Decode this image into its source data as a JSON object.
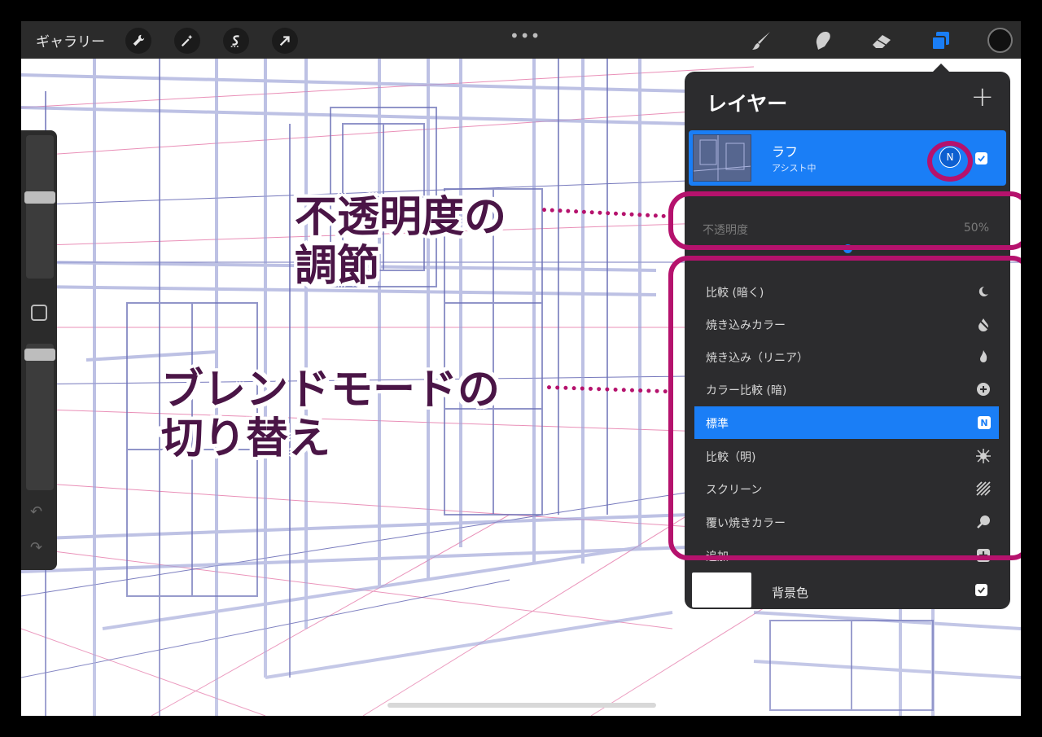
{
  "toolbar": {
    "gallery": "ギャラリー",
    "more": "•••",
    "tools_left": [
      "wrench-icon",
      "magic-wand-icon",
      "selection-s-icon",
      "transform-arrow-icon"
    ],
    "tools_right": [
      "brush-icon",
      "smudge-icon",
      "eraser-icon",
      "layers-icon"
    ]
  },
  "layers_panel": {
    "title": "レイヤー",
    "add": "+",
    "active_layer": {
      "name": "ラフ",
      "subtitle": "アシスト中",
      "blend_badge": "N"
    },
    "opacity": {
      "label": "不透明度",
      "value_text": "50%",
      "value": 0.5
    },
    "blend_modes": [
      {
        "label": "比較 (暗く)",
        "icon": "moon-icon",
        "active": false
      },
      {
        "label": "焼き込みカラー",
        "icon": "burn-drop-icon",
        "active": false
      },
      {
        "label": "焼き込み（リニア）",
        "icon": "flame-icon",
        "active": false
      },
      {
        "label": "カラー比較 (暗)",
        "icon": "plus-circle-icon",
        "active": false
      },
      {
        "label": "標準",
        "icon": "n-badge-icon",
        "active": true
      },
      {
        "label": "比較（明)",
        "icon": "sun-burst-icon",
        "active": false
      },
      {
        "label": "スクリーン",
        "icon": "hatch-square-icon",
        "active": false
      },
      {
        "label": "覆い焼きカラー",
        "icon": "search-balloon-icon",
        "active": false
      },
      {
        "label": "追加",
        "icon": "plus-square-icon",
        "active": false
      }
    ],
    "active_badge": "N",
    "background_layer": {
      "name": "背景色"
    }
  },
  "annotations": {
    "opacity_note_line1": "不透明度の",
    "opacity_note_line2": "調節",
    "blend_note_line1": "ブレンドモードの",
    "blend_note_line2": "切り替え"
  },
  "colors": {
    "accent": "#1a7ef6",
    "annotation": "#b5126d",
    "annotation_text": "#4a1546",
    "panel": "#2c2c2e",
    "toolbar": "#2b2b2b"
  }
}
